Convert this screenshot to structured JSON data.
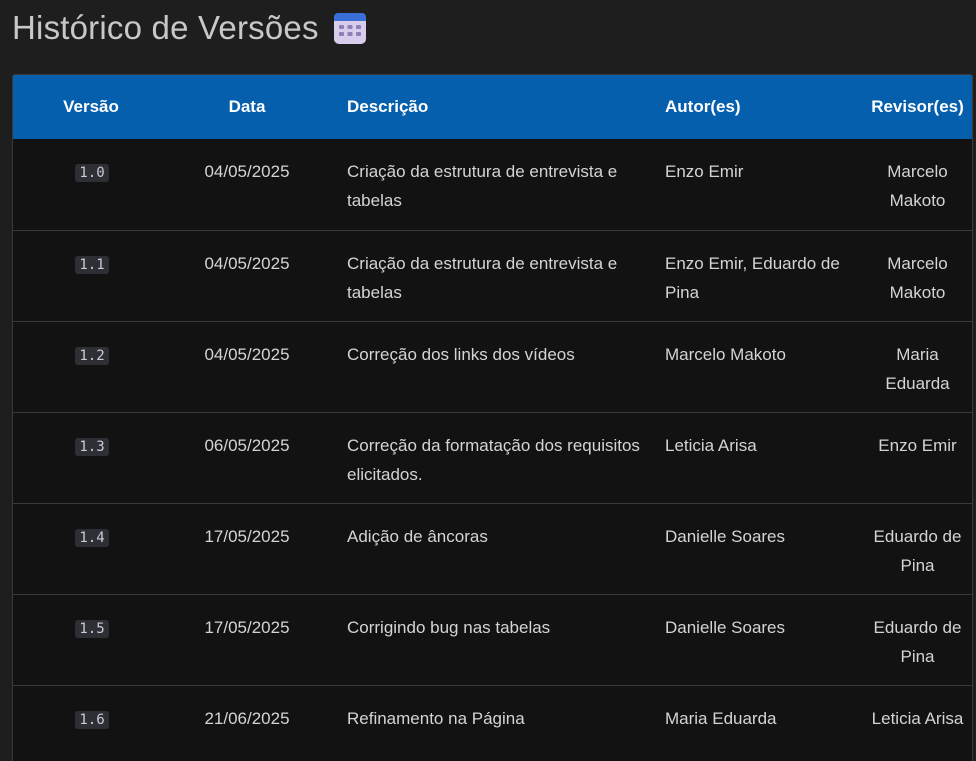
{
  "page": {
    "title": "Histórico de Versões",
    "title_icon": "calendar-icon"
  },
  "table": {
    "headers": {
      "version": "Versão",
      "date": "Data",
      "description": "Descrição",
      "authors": "Autor(es)",
      "reviewers": "Revisor(es)"
    },
    "rows": [
      {
        "version": "1.0",
        "date": "04/05/2025",
        "description": "Criação da estrutura de entrevista e tabelas",
        "authors": "Enzo Emir",
        "reviewers": "Marcelo Makoto"
      },
      {
        "version": "1.1",
        "date": "04/05/2025",
        "description": "Criação da estrutura de entrevista e tabelas",
        "authors": "Enzo Emir, Eduardo de Pina",
        "reviewers": "Marcelo Makoto"
      },
      {
        "version": "1.2",
        "date": "04/05/2025",
        "description": "Correção dos links dos vídeos",
        "authors": "Marcelo Makoto",
        "reviewers": "Maria Eduarda"
      },
      {
        "version": "1.3",
        "date": "06/05/2025",
        "description": "Correção da formatação dos requisitos elicitados.",
        "authors": "Leticia Arisa",
        "reviewers": "Enzo Emir"
      },
      {
        "version": "1.4",
        "date": "17/05/2025",
        "description": "Adição de âncoras",
        "authors": "Danielle Soares",
        "reviewers": "Eduardo de Pina"
      },
      {
        "version": "1.5",
        "date": "17/05/2025",
        "description": "Corrigindo bug nas tabelas",
        "authors": "Danielle Soares",
        "reviewers": "Eduardo de Pina"
      },
      {
        "version": "1.6",
        "date": "21/06/2025",
        "description": "Refinamento na Página",
        "authors": "Maria Eduarda",
        "reviewers": "Leticia Arisa"
      }
    ]
  },
  "colors": {
    "header_bg": "#065fac",
    "page_bg": "#1e1e1e",
    "table_bg": "#121212",
    "border": "#3a3a3a"
  }
}
